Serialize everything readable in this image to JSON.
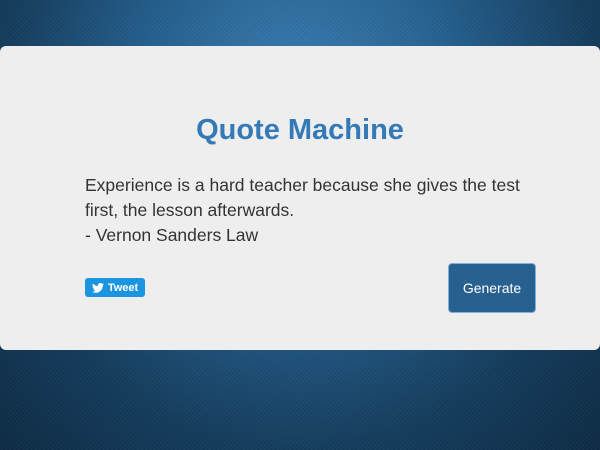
{
  "app": {
    "title": "Quote Machine"
  },
  "quote": {
    "text": "Experience is a hard teacher because she gives the test first, the lesson afterwards.",
    "author": "- Vernon Sanders Law"
  },
  "actions": {
    "tweet_label": "Tweet",
    "generate_label": "Generate"
  },
  "icons": {
    "tweet": "twitter-bird-icon"
  },
  "colors": {
    "title": "#337ab7",
    "tweet_button": "#1b95e0",
    "generate_button": "#286090",
    "card_background": "#eeeeef"
  }
}
